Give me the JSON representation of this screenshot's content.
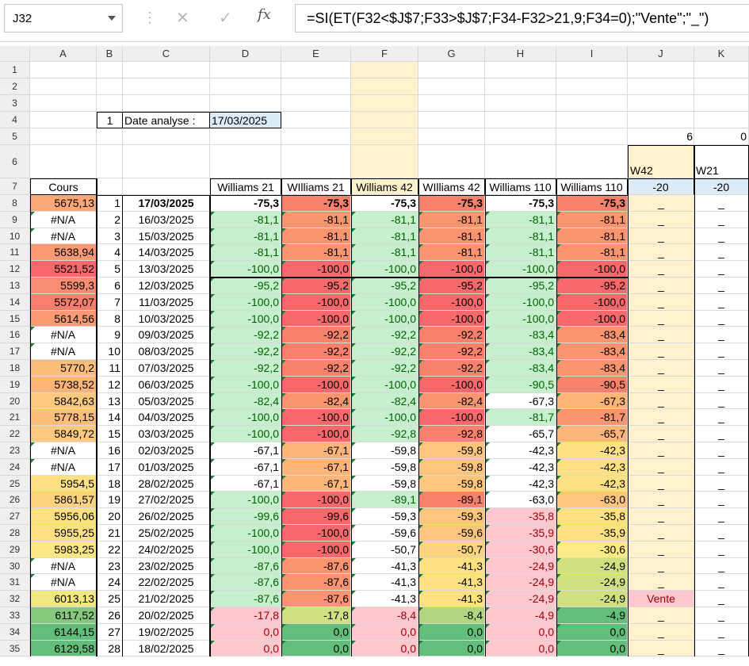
{
  "formula_bar": {
    "name_box": "J32",
    "cancel_icon": "✕",
    "enter_icon": "✓",
    "fx_label": "fx",
    "formula": "=SI(ET(F32<$J$7;F33>$J$7;F34-F32>21,9;F34=0);\"Vente\";\"_\")"
  },
  "columns": [
    "A",
    "B",
    "C",
    "D",
    "E",
    "F",
    "G",
    "H",
    "I",
    "J",
    "K"
  ],
  "top": {
    "b4": "1",
    "c4": "Date analyse :",
    "d4": "17/03/2025",
    "j5": "6",
    "k5": "0",
    "j6": "W42",
    "k6": "W21"
  },
  "headers7": [
    "Cours",
    "",
    "",
    "Williams 21",
    "WIlliams 21",
    "Williams 42",
    "WIlliams 42",
    "Williams 110",
    "Williams 110",
    "-20",
    "-20"
  ],
  "rows": [
    {
      "r": "8",
      "a": "5675,13",
      "b": "1",
      "c": "17/03/2025",
      "d": "-75,3",
      "e": "-75,3",
      "f": "-75,3",
      "g": "-75,3",
      "h": "-75,3",
      "i": "-75,3",
      "j": "_",
      "k": "_"
    },
    {
      "r": "9",
      "a": "#N/A",
      "b": "2",
      "c": "16/03/2025",
      "d": "-81,1",
      "e": "-81,1",
      "f": "-81,1",
      "g": "-81,1",
      "h": "-81,1",
      "i": "-81,1",
      "j": "_",
      "k": "_"
    },
    {
      "r": "10",
      "a": "#N/A",
      "b": "3",
      "c": "15/03/2025",
      "d": "-81,1",
      "e": "-81,1",
      "f": "-81,1",
      "g": "-81,1",
      "h": "-81,1",
      "i": "-81,1",
      "j": "_",
      "k": "_"
    },
    {
      "r": "11",
      "a": "5638,94",
      "b": "4",
      "c": "14/03/2025",
      "d": "-81,1",
      "e": "-81,1",
      "f": "-81,1",
      "g": "-81,1",
      "h": "-81,1",
      "i": "-81,1",
      "j": "_",
      "k": "_"
    },
    {
      "r": "12",
      "a": "5521,52",
      "b": "5",
      "c": "13/03/2025",
      "d": "-100,0",
      "e": "-100,0",
      "f": "-100,0",
      "g": "-100,0",
      "h": "-100,0",
      "i": "-100,0",
      "j": "_",
      "k": "_"
    },
    {
      "r": "13",
      "a": "5599,3",
      "b": "6",
      "c": "12/03/2025",
      "d": "-95,2",
      "e": "-95,2",
      "f": "-95,2",
      "g": "-95,2",
      "h": "-95,2",
      "i": "-95,2",
      "j": "_",
      "k": "_"
    },
    {
      "r": "14",
      "a": "5572,07",
      "b": "7",
      "c": "11/03/2025",
      "d": "-100,0",
      "e": "-100,0",
      "f": "-100,0",
      "g": "-100,0",
      "h": "-100,0",
      "i": "-100,0",
      "j": "_",
      "k": "_"
    },
    {
      "r": "15",
      "a": "5614,56",
      "b": "8",
      "c": "10/03/2025",
      "d": "-100,0",
      "e": "-100,0",
      "f": "-100,0",
      "g": "-100,0",
      "h": "-100,0",
      "i": "-100,0",
      "j": "_",
      "k": "_"
    },
    {
      "r": "16",
      "a": "#N/A",
      "b": "9",
      "c": "09/03/2025",
      "d": "-92,2",
      "e": "-92,2",
      "f": "-92,2",
      "g": "-92,2",
      "h": "-83,4",
      "i": "-83,4",
      "j": "_",
      "k": "_"
    },
    {
      "r": "17",
      "a": "#N/A",
      "b": "10",
      "c": "08/03/2025",
      "d": "-92,2",
      "e": "-92,2",
      "f": "-92,2",
      "g": "-92,2",
      "h": "-83,4",
      "i": "-83,4",
      "j": "_",
      "k": "_"
    },
    {
      "r": "18",
      "a": "5770,2",
      "b": "11",
      "c": "07/03/2025",
      "d": "-92,2",
      "e": "-92,2",
      "f": "-92,2",
      "g": "-92,2",
      "h": "-83,4",
      "i": "-83,4",
      "j": "_",
      "k": "_"
    },
    {
      "r": "19",
      "a": "5738,52",
      "b": "12",
      "c": "06/03/2025",
      "d": "-100,0",
      "e": "-100,0",
      "f": "-100,0",
      "g": "-100,0",
      "h": "-90,5",
      "i": "-90,5",
      "j": "_",
      "k": "_"
    },
    {
      "r": "20",
      "a": "5842,63",
      "b": "13",
      "c": "05/03/2025",
      "d": "-82,4",
      "e": "-82,4",
      "f": "-82,4",
      "g": "-82,4",
      "h": "-67,3",
      "i": "-67,3",
      "j": "_",
      "k": "_"
    },
    {
      "r": "21",
      "a": "5778,15",
      "b": "14",
      "c": "04/03/2025",
      "d": "-100,0",
      "e": "-100,0",
      "f": "-100,0",
      "g": "-100,0",
      "h": "-81,7",
      "i": "-81,7",
      "j": "_",
      "k": "_"
    },
    {
      "r": "22",
      "a": "5849,72",
      "b": "15",
      "c": "03/03/2025",
      "d": "-100,0",
      "e": "-100,0",
      "f": "-92,8",
      "g": "-92,8",
      "h": "-65,7",
      "i": "-65,7",
      "j": "_",
      "k": "_"
    },
    {
      "r": "23",
      "a": "#N/A",
      "b": "16",
      "c": "02/03/2025",
      "d": "-67,1",
      "e": "-67,1",
      "f": "-59,8",
      "g": "-59,8",
      "h": "-42,3",
      "i": "-42,3",
      "j": "_",
      "k": "_"
    },
    {
      "r": "24",
      "a": "#N/A",
      "b": "17",
      "c": "01/03/2025",
      "d": "-67,1",
      "e": "-67,1",
      "f": "-59,8",
      "g": "-59,8",
      "h": "-42,3",
      "i": "-42,3",
      "j": "_",
      "k": "_"
    },
    {
      "r": "25",
      "a": "5954,5",
      "b": "18",
      "c": "28/02/2025",
      "d": "-67,1",
      "e": "-67,1",
      "f": "-59,8",
      "g": "-59,8",
      "h": "-42,3",
      "i": "-42,3",
      "j": "_",
      "k": "_"
    },
    {
      "r": "26",
      "a": "5861,57",
      "b": "19",
      "c": "27/02/2025",
      "d": "-100,0",
      "e": "-100,0",
      "f": "-89,1",
      "g": "-89,1",
      "h": "-63,0",
      "i": "-63,0",
      "j": "_",
      "k": "_"
    },
    {
      "r": "27",
      "a": "5956,06",
      "b": "20",
      "c": "26/02/2025",
      "d": "-99,6",
      "e": "-99,6",
      "f": "-59,3",
      "g": "-59,3",
      "h": "-35,8",
      "i": "-35,8",
      "j": "_",
      "k": "_"
    },
    {
      "r": "28",
      "a": "5955,25",
      "b": "21",
      "c": "25/02/2025",
      "d": "-100,0",
      "e": "-100,0",
      "f": "-59,6",
      "g": "-59,6",
      "h": "-35,9",
      "i": "-35,9",
      "j": "_",
      "k": "_"
    },
    {
      "r": "29",
      "a": "5983,25",
      "b": "22",
      "c": "24/02/2025",
      "d": "-100,0",
      "e": "-100,0",
      "f": "-50,7",
      "g": "-50,7",
      "h": "-30,6",
      "i": "-30,6",
      "j": "_",
      "k": "_"
    },
    {
      "r": "30",
      "a": "#N/A",
      "b": "23",
      "c": "23/02/2025",
      "d": "-87,6",
      "e": "-87,6",
      "f": "-41,3",
      "g": "-41,3",
      "h": "-24,9",
      "i": "-24,9",
      "j": "_",
      "k": "_"
    },
    {
      "r": "31",
      "a": "#N/A",
      "b": "24",
      "c": "22/02/2025",
      "d": "-87,6",
      "e": "-87,6",
      "f": "-41,3",
      "g": "-41,3",
      "h": "-24,9",
      "i": "-24,9",
      "j": "_",
      "k": "_"
    },
    {
      "r": "32",
      "a": "6013,13",
      "b": "25",
      "c": "21/02/2025",
      "d": "-87,6",
      "e": "-87,6",
      "f": "-41,3",
      "g": "-41,3",
      "h": "-24,9",
      "i": "-24,9",
      "j": "Vente",
      "k": "_"
    },
    {
      "r": "33",
      "a": "6117,52",
      "b": "26",
      "c": "20/02/2025",
      "d": "-17,8",
      "e": "-17,8",
      "f": "-8,4",
      "g": "-8,4",
      "h": "-4,9",
      "i": "-4,9",
      "j": "_",
      "k": "_"
    },
    {
      "r": "34",
      "a": "6144,15",
      "b": "27",
      "c": "19/02/2025",
      "d": "0,0",
      "e": "0,0",
      "f": "0,0",
      "g": "0,0",
      "h": "0,0",
      "i": "0,0",
      "j": "_",
      "k": "_"
    },
    {
      "r": "35",
      "a": "6129,58",
      "b": "28",
      "c": "18/02/2025",
      "d": "0,0",
      "e": "0,0",
      "f": "0,0",
      "g": "0,0",
      "h": "0,0",
      "i": "0,0",
      "j": "_",
      "k": "_"
    }
  ],
  "colors": {
    "green_fill": "#c6efce",
    "green_text": "#006100",
    "pink_fill": "#ffc7ce",
    "pink_text": "#9c0006",
    "yellow_col": "#fff2cc",
    "blue_fill": "#ddebf7",
    "header_bg": "#efefef"
  }
}
